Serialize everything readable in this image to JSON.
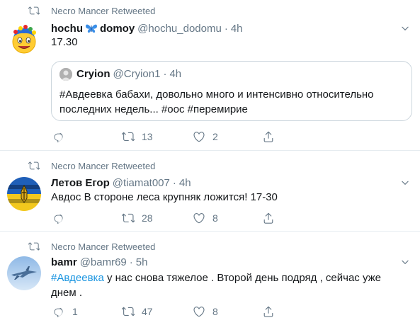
{
  "tweets": [
    {
      "retweeted_by": "Necro Mancer Retweeted",
      "name_part1": "hochu",
      "name_part2": "domoy",
      "handle": "@hochu_dodomu",
      "time": "4h",
      "text": "17.30",
      "quote": {
        "name": "Cryion",
        "handle": "@Cryion1",
        "time": "4h",
        "text": "#Авдеевка бабахи, довольно много и интенсивно относительно последних недель... #оос #перемирие"
      },
      "replies": "",
      "retweets": "13",
      "likes": "2"
    },
    {
      "retweeted_by": "Necro Mancer Retweeted",
      "name": "Летов Егор",
      "handle": "@tiamat007",
      "time": "4h",
      "text": "Авдос В стороне леса крупняк ложится! 17-30",
      "replies": "",
      "retweets": "28",
      "likes": "8"
    },
    {
      "retweeted_by": "Necro Mancer Retweeted",
      "name": "bamr",
      "handle": "@bamr69",
      "time": "5h",
      "text_hashtag": "#Авдеевка",
      "text_rest": " у нас снова тяжелое . Второй день подряд , сейчас уже днем .",
      "replies": "1",
      "retweets": "47",
      "likes": "8"
    }
  ],
  "separator": "·",
  "colors": {
    "accent": "#1b95e0",
    "muted": "#657786",
    "border": "#e6ecf0"
  }
}
